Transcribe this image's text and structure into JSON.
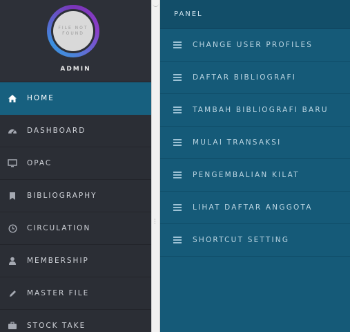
{
  "sidebar": {
    "avatar_text": [
      "FILE NOT",
      "FOUND"
    ],
    "user_name": "ADMIN",
    "items": [
      {
        "label": "HOME",
        "icon": "home-icon",
        "active": true
      },
      {
        "label": "DASHBOARD",
        "icon": "dashboard-icon",
        "active": false
      },
      {
        "label": "OPAC",
        "icon": "monitor-icon",
        "active": false
      },
      {
        "label": "BIBLIOGRAPHY",
        "icon": "bookmark-icon",
        "active": false
      },
      {
        "label": "CIRCULATION",
        "icon": "clock-icon",
        "active": false
      },
      {
        "label": "MEMBERSHIP",
        "icon": "user-icon",
        "active": false
      },
      {
        "label": "MASTER FILE",
        "icon": "pencil-icon",
        "active": false
      },
      {
        "label": "STOCK TAKE",
        "icon": "briefcase-icon",
        "active": false
      }
    ]
  },
  "panel": {
    "title": "PANEL",
    "items": [
      {
        "label": "CHANGE USER PROFILES",
        "icon": "menu-lines-icon"
      },
      {
        "label": "DAFTAR BIBLIOGRAFI",
        "icon": "menu-lines-icon"
      },
      {
        "label": "TAMBAH BIBLIOGRAFI BARU",
        "icon": "menu-lines-icon"
      },
      {
        "label": "MULAI TRANSAKSI",
        "icon": "menu-lines-icon"
      },
      {
        "label": "PENGEMBALIAN KILAT",
        "icon": "menu-lines-icon"
      },
      {
        "label": "LIHAT DAFTAR ANGGOTA",
        "icon": "menu-lines-icon"
      },
      {
        "label": "SHORTCUT SETTING",
        "icon": "menu-lines-icon"
      }
    ]
  },
  "colors": {
    "sidebar_bg": "#2b2e35",
    "active_bg": "#17607f",
    "panel_bg": "#155a78",
    "panel_header_bg": "#124e69",
    "avatar_ring": [
      "#7a34b8",
      "#3b90e0"
    ]
  }
}
